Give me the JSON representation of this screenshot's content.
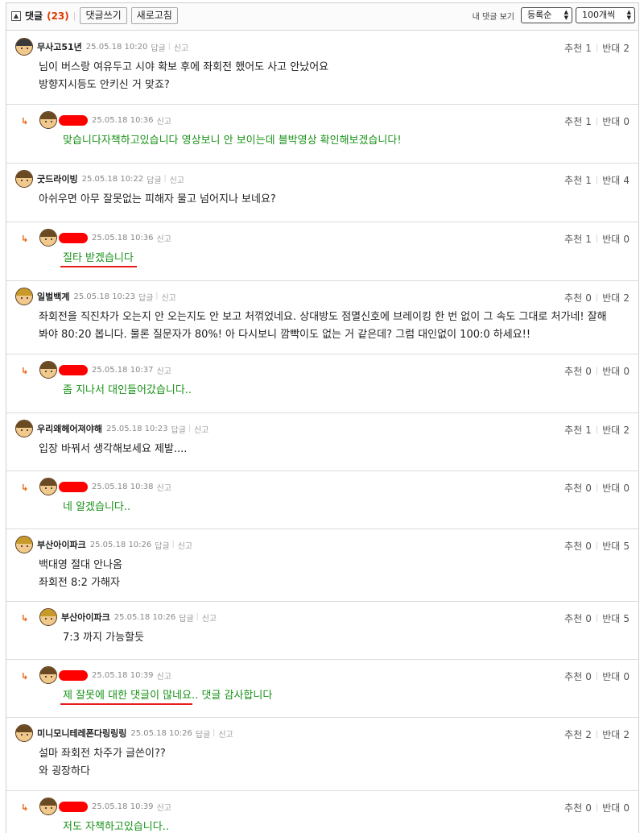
{
  "toolbar": {
    "toggle_symbol": "▲",
    "title": "댓글",
    "count": "(23)",
    "write_button": "댓글쓰기",
    "refresh_button": "새로고침",
    "my_comments_label": "내 댓글 보기",
    "sort_select": "등록순",
    "page_size_select": "100개씩"
  },
  "labels": {
    "reply": "답글",
    "report": "신고",
    "recommend": "추천",
    "oppose": "반대",
    "reply_marker": "↳"
  },
  "comments": [
    {
      "nick": "무사고51년",
      "date": "25.05.18 10:20",
      "up": "1",
      "down": "2",
      "lines": [
        "님이 버스랑 여유두고 시야 확보 후에 좌회전 했어도 사고 안났어요",
        "방향지시등도 안키신 거 맞죠?"
      ]
    },
    {
      "nick": "",
      "date": "25.05.18 10:36",
      "up": "1",
      "down": "0",
      "lines": [
        "맞습니다자책하고있습니다 영상보니 안 보이는데 블박영상 확인해보겠습니다!"
      ]
    },
    {
      "nick": "굿드라이빙",
      "date": "25.05.18 10:22",
      "up": "1",
      "down": "4",
      "lines": [
        "아쉬우면 아무 잘못없는 피해자 물고 넘어지나 보네요?"
      ]
    },
    {
      "nick": "",
      "date": "25.05.18 10:36",
      "up": "1",
      "down": "0",
      "lines": [
        "질타 받겠습니다"
      ]
    },
    {
      "nick": "일벌백계",
      "date": "25.05.18 10:23",
      "up": "0",
      "down": "2",
      "lines": [
        "좌회전을 직진차가 오는지 안 오는지도 안 보고 처꺾었네요. 상대방도 점멸신호에 브레이킹 한 번 없이 그 속도 그대로 처가네! 잘해",
        "봐야 80:20 봅니다. 물론 질문자가 80%! 아 다시보니 깜빡이도 없는 거 같은데? 그럼 대인없이 100:0 하세요!!"
      ]
    },
    {
      "nick": "",
      "date": "25.05.18 10:37",
      "up": "0",
      "down": "0",
      "lines": [
        "좀 지나서 대인들어갔습니다.."
      ]
    },
    {
      "nick": "우리왜헤어져야해",
      "date": "25.05.18 10:23",
      "up": "1",
      "down": "2",
      "lines": [
        "입장 바꿔서 생각해보세요 제발...."
      ]
    },
    {
      "nick": "",
      "date": "25.05.18 10:38",
      "up": "0",
      "down": "0",
      "lines": [
        "네 알겠습니다.."
      ]
    },
    {
      "nick": "부산아이파크",
      "date": "25.05.18 10:26",
      "up": "0",
      "down": "5",
      "lines": [
        "백대영 절대 안나옴",
        "좌회전 8:2 가해자"
      ]
    },
    {
      "nick": "부산아이파크",
      "date": "25.05.18 10:26",
      "up": "0",
      "down": "5",
      "lines": [
        "7:3 까지 가능할듯"
      ]
    },
    {
      "nick": "",
      "date": "25.05.18 10:39",
      "up": "0",
      "down": "0",
      "lines": [
        "제 잘못에 대한 댓글이 많네요.. 댓글 감사합니다"
      ]
    },
    {
      "nick": "미니모니테레폰다링링링",
      "date": "25.05.18 10:26",
      "up": "2",
      "down": "2",
      "lines": [
        "설마 좌회전 차주가 글쓴이??",
        "와 굉장하다"
      ]
    },
    {
      "nick": "",
      "date": "25.05.18 10:39",
      "up": "0",
      "down": "0",
      "lines": [
        "저도 자책하고있습니다.."
      ]
    }
  ],
  "colors": {
    "author_reply": "#179117",
    "highlight_underline": "#e81c1c",
    "count": "#e03a00",
    "redaction": "#ff0000"
  }
}
